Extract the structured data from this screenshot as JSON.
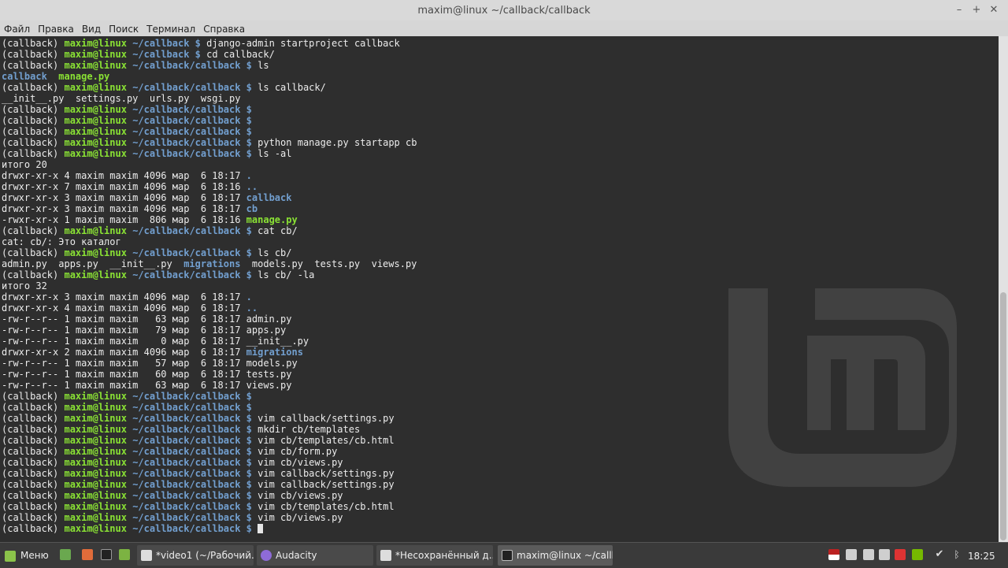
{
  "window": {
    "title": "maxim@linux ~/callback/callback"
  },
  "menu": [
    "Файл",
    "Правка",
    "Вид",
    "Поиск",
    "Терминал",
    "Справка"
  ],
  "colors": {
    "user": "#8ae234",
    "path": "#729fcf",
    "text": "#e6e6e6",
    "dir": "#729fcf",
    "exec": "#8ae234"
  },
  "terminal": {
    "lines": [
      [
        [
          "v",
          "(callback) "
        ],
        [
          "g",
          "maxim@linux"
        ],
        [
          "b",
          " ~/callback $"
        ],
        [
          "v",
          " django-admin startproject callback"
        ]
      ],
      [
        [
          "v",
          "(callback) "
        ],
        [
          "g",
          "maxim@linux"
        ],
        [
          "b",
          " ~/callback $"
        ],
        [
          "v",
          " cd callback/"
        ]
      ],
      [
        [
          "v",
          "(callback) "
        ],
        [
          "g",
          "maxim@linux"
        ],
        [
          "b",
          " ~/callback/callback $"
        ],
        [
          "v",
          " ls"
        ]
      ],
      [
        [
          "b",
          "callback"
        ],
        [
          "v",
          "  "
        ],
        [
          "g",
          "manage.py"
        ]
      ],
      [
        [
          "v",
          "(callback) "
        ],
        [
          "g",
          "maxim@linux"
        ],
        [
          "b",
          " ~/callback/callback $"
        ],
        [
          "v",
          " ls callback/"
        ]
      ],
      [
        [
          "v",
          "__init__.py  settings.py  urls.py  wsgi.py"
        ]
      ],
      [
        [
          "v",
          "(callback) "
        ],
        [
          "g",
          "maxim@linux"
        ],
        [
          "b",
          " ~/callback/callback $"
        ]
      ],
      [
        [
          "v",
          "(callback) "
        ],
        [
          "g",
          "maxim@linux"
        ],
        [
          "b",
          " ~/callback/callback $"
        ]
      ],
      [
        [
          "v",
          "(callback) "
        ],
        [
          "g",
          "maxim@linux"
        ],
        [
          "b",
          " ~/callback/callback $"
        ]
      ],
      [
        [
          "v",
          "(callback) "
        ],
        [
          "g",
          "maxim@linux"
        ],
        [
          "b",
          " ~/callback/callback $"
        ],
        [
          "v",
          " python manage.py startapp cb"
        ]
      ],
      [
        [
          "v",
          "(callback) "
        ],
        [
          "g",
          "maxim@linux"
        ],
        [
          "b",
          " ~/callback/callback $"
        ],
        [
          "v",
          " ls -al"
        ]
      ],
      [
        [
          "v",
          "итого 20"
        ]
      ],
      [
        [
          "v",
          "drwxr-xr-x 4 maxim maxim 4096 мар  6 18:17 "
        ],
        [
          "b",
          "."
        ]
      ],
      [
        [
          "v",
          "drwxr-xr-x 7 maxim maxim 4096 мар  6 18:16 "
        ],
        [
          "b",
          ".."
        ]
      ],
      [
        [
          "v",
          "drwxr-xr-x 3 maxim maxim 4096 мар  6 18:17 "
        ],
        [
          "b",
          "callback"
        ]
      ],
      [
        [
          "v",
          "drwxr-xr-x 3 maxim maxim 4096 мар  6 18:17 "
        ],
        [
          "b",
          "cb"
        ]
      ],
      [
        [
          "v",
          "-rwxr-xr-x 1 maxim maxim  806 мар  6 18:16 "
        ],
        [
          "g",
          "manage.py"
        ]
      ],
      [
        [
          "v",
          "(callback) "
        ],
        [
          "g",
          "maxim@linux"
        ],
        [
          "b",
          " ~/callback/callback $"
        ],
        [
          "v",
          " cat cb/"
        ]
      ],
      [
        [
          "v",
          "cat: cb/: Это каталог"
        ]
      ],
      [
        [
          "v",
          "(callback) "
        ],
        [
          "g",
          "maxim@linux"
        ],
        [
          "b",
          " ~/callback/callback $"
        ],
        [
          "v",
          " ls cb/"
        ]
      ],
      [
        [
          "v",
          "admin.py  apps.py  __init__.py  "
        ],
        [
          "b",
          "migrations"
        ],
        [
          "v",
          "  models.py  tests.py  views.py"
        ]
      ],
      [
        [
          "v",
          "(callback) "
        ],
        [
          "g",
          "maxim@linux"
        ],
        [
          "b",
          " ~/callback/callback $"
        ],
        [
          "v",
          " ls cb/ -la"
        ]
      ],
      [
        [
          "v",
          "итого 32"
        ]
      ],
      [
        [
          "v",
          "drwxr-xr-x 3 maxim maxim 4096 мар  6 18:17 "
        ],
        [
          "b",
          "."
        ]
      ],
      [
        [
          "v",
          "drwxr-xr-x 4 maxim maxim 4096 мар  6 18:17 "
        ],
        [
          "b",
          ".."
        ]
      ],
      [
        [
          "v",
          "-rw-r--r-- 1 maxim maxim   63 мар  6 18:17 admin.py"
        ]
      ],
      [
        [
          "v",
          "-rw-r--r-- 1 maxim maxim   79 мар  6 18:17 apps.py"
        ]
      ],
      [
        [
          "v",
          "-rw-r--r-- 1 maxim maxim    0 мар  6 18:17 __init__.py"
        ]
      ],
      [
        [
          "v",
          "drwxr-xr-x 2 maxim maxim 4096 мар  6 18:17 "
        ],
        [
          "b",
          "migrations"
        ]
      ],
      [
        [
          "v",
          "-rw-r--r-- 1 maxim maxim   57 мар  6 18:17 models.py"
        ]
      ],
      [
        [
          "v",
          "-rw-r--r-- 1 maxim maxim   60 мар  6 18:17 tests.py"
        ]
      ],
      [
        [
          "v",
          "-rw-r--r-- 1 maxim maxim   63 мар  6 18:17 views.py"
        ]
      ],
      [
        [
          "v",
          "(callback) "
        ],
        [
          "g",
          "maxim@linux"
        ],
        [
          "b",
          " ~/callback/callback $"
        ]
      ],
      [
        [
          "v",
          "(callback) "
        ],
        [
          "g",
          "maxim@linux"
        ],
        [
          "b",
          " ~/callback/callback $"
        ]
      ],
      [
        [
          "v",
          "(callback) "
        ],
        [
          "g",
          "maxim@linux"
        ],
        [
          "b",
          " ~/callback/callback $"
        ],
        [
          "v",
          " vim callback/settings.py"
        ]
      ],
      [
        [
          "v",
          "(callback) "
        ],
        [
          "g",
          "maxim@linux"
        ],
        [
          "b",
          " ~/callback/callback $"
        ],
        [
          "v",
          " mkdir cb/templates"
        ]
      ],
      [
        [
          "v",
          "(callback) "
        ],
        [
          "g",
          "maxim@linux"
        ],
        [
          "b",
          " ~/callback/callback $"
        ],
        [
          "v",
          " vim cb/templates/cb.html"
        ]
      ],
      [
        [
          "v",
          "(callback) "
        ],
        [
          "g",
          "maxim@linux"
        ],
        [
          "b",
          " ~/callback/callback $"
        ],
        [
          "v",
          " vim cb/form.py"
        ]
      ],
      [
        [
          "v",
          "(callback) "
        ],
        [
          "g",
          "maxim@linux"
        ],
        [
          "b",
          " ~/callback/callback $"
        ],
        [
          "v",
          " vim cb/views.py"
        ]
      ],
      [
        [
          "v",
          "(callback) "
        ],
        [
          "g",
          "maxim@linux"
        ],
        [
          "b",
          " ~/callback/callback $"
        ],
        [
          "v",
          " vim callback/settings.py"
        ]
      ],
      [
        [
          "v",
          "(callback) "
        ],
        [
          "g",
          "maxim@linux"
        ],
        [
          "b",
          " ~/callback/callback $"
        ],
        [
          "v",
          " vim callback/settings.py"
        ]
      ],
      [
        [
          "v",
          "(callback) "
        ],
        [
          "g",
          "maxim@linux"
        ],
        [
          "b",
          " ~/callback/callback $"
        ],
        [
          "v",
          " vim cb/views.py"
        ]
      ],
      [
        [
          "v",
          "(callback) "
        ],
        [
          "g",
          "maxim@linux"
        ],
        [
          "b",
          " ~/callback/callback $"
        ],
        [
          "v",
          " vim cb/templates/cb.html"
        ]
      ],
      [
        [
          "v",
          "(callback) "
        ],
        [
          "g",
          "maxim@linux"
        ],
        [
          "b",
          " ~/callback/callback $"
        ],
        [
          "v",
          " vim cb/views.py"
        ]
      ],
      [
        [
          "v",
          "(callback) "
        ],
        [
          "g",
          "maxim@linux"
        ],
        [
          "b",
          " ~/callback/callback $"
        ],
        [
          "v",
          " "
        ]
      ]
    ]
  },
  "taskbar": {
    "menu_label": "Меню",
    "windows": [
      {
        "label": "*video1 (~/Рабочий...",
        "icon": "text-editor-icon",
        "active": false
      },
      {
        "label": "Audacity",
        "icon": "audacity-icon",
        "active": false
      },
      {
        "label": "*Несохранённый д...",
        "icon": "text-editor-icon",
        "active": false
      },
      {
        "label": "maxim@linux ~/callb...",
        "icon": "terminal-icon",
        "active": true
      }
    ],
    "clock": "18:25"
  }
}
